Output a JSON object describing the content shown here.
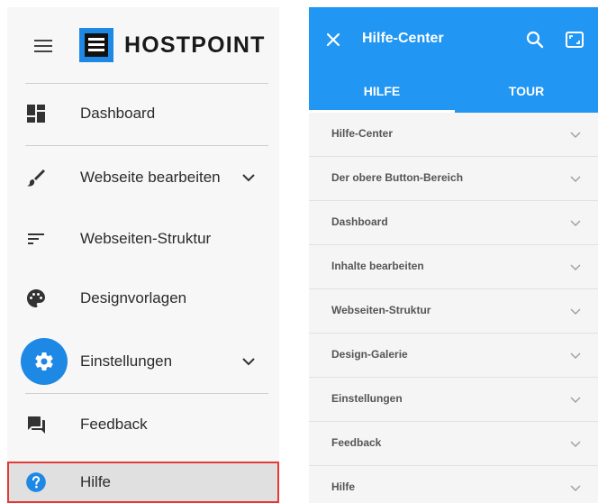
{
  "drawer": {
    "brand_name": "HOSTPOINT",
    "items": [
      {
        "label": "Dashboard",
        "icon": "dashboard-icon"
      },
      {
        "label": "Webseite bearbeiten",
        "icon": "brush-icon",
        "expandable": true
      },
      {
        "label": "Webseiten-Struktur",
        "icon": "sort-lines-icon"
      },
      {
        "label": "Designvorlagen",
        "icon": "palette-icon"
      },
      {
        "label": "Einstellungen",
        "icon": "gear-icon",
        "expandable": true
      },
      {
        "label": "Feedback",
        "icon": "feedback-icon"
      },
      {
        "label": "Hilfe",
        "icon": "help-circle-icon",
        "selected": true
      }
    ]
  },
  "help_center": {
    "title": "Hilfe-Center",
    "tabs": [
      {
        "label": "HILFE",
        "active": true
      },
      {
        "label": "TOUR",
        "active": false
      }
    ],
    "topics": [
      "Hilfe-Center",
      "Der obere Button-Bereich",
      "Dashboard",
      "Inhalte bearbeiten",
      "Webseiten-Struktur",
      "Design-Galerie",
      "Einstellungen",
      "Feedback",
      "Hilfe"
    ]
  },
  "colors": {
    "accent": "#2196f3",
    "brand_blue": "#1e88e5",
    "selected_border": "#e53935",
    "selected_bg": "#e0e0e0"
  }
}
